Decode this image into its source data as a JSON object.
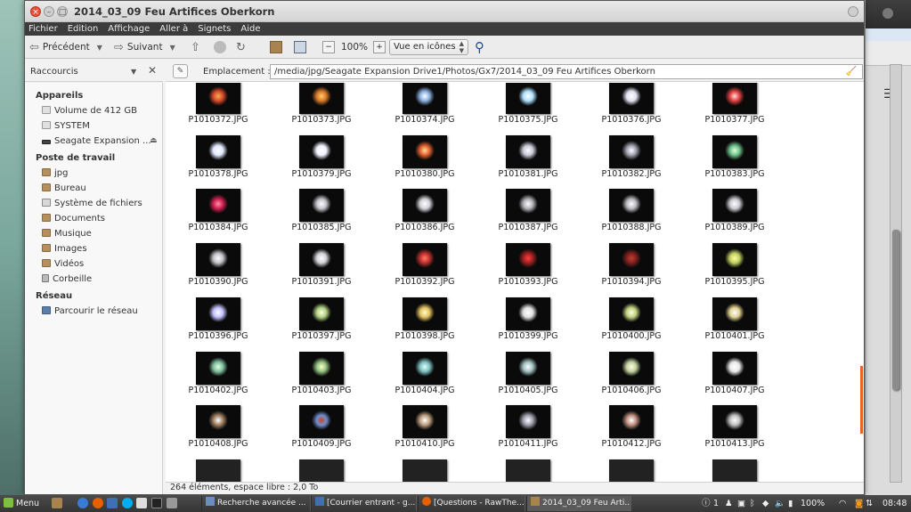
{
  "window": {
    "title": "2014_03_09 Feu Artifices Oberkorn"
  },
  "menubar": [
    "Fichier",
    "Edition",
    "Affichage",
    "Aller à",
    "Signets",
    "Aide"
  ],
  "toolbar": {
    "back_label": "Précédent",
    "forward_label": "Suivant",
    "zoom": "100%",
    "view_mode": "Vue en icônes"
  },
  "sidebar": {
    "header": "Raccourcis",
    "sections": [
      {
        "title": "Appareils",
        "items": [
          {
            "label": "Volume de 412 GB",
            "icon": "drive-icon"
          },
          {
            "label": "SYSTEM",
            "icon": "drive-icon"
          },
          {
            "label": "Seagate Expansion ...",
            "icon": "usb-drive-icon"
          }
        ]
      },
      {
        "title": "Poste de travail",
        "items": [
          {
            "label": "jpg",
            "icon": "folder-icon"
          },
          {
            "label": "Bureau",
            "icon": "folder-icon"
          },
          {
            "label": "Système de fichiers",
            "icon": "filesystem-icon"
          },
          {
            "label": "Documents",
            "icon": "folder-icon"
          },
          {
            "label": "Musique",
            "icon": "folder-icon"
          },
          {
            "label": "Images",
            "icon": "folder-icon"
          },
          {
            "label": "Vidéos",
            "icon": "folder-icon"
          },
          {
            "label": "Corbeille",
            "icon": "trash-icon"
          }
        ]
      },
      {
        "title": "Réseau",
        "items": [
          {
            "label": "Parcourir le réseau",
            "icon": "network-icon"
          }
        ]
      }
    ]
  },
  "location": {
    "label": "Emplacement :",
    "path": "/media/jpg/Seagate Expansion Drive1/Photos/Gx7/2014_03_09 Feu Artifices Oberkorn"
  },
  "files": [
    "P1010372.JPG",
    "P1010373.JPG",
    "P1010374.JPG",
    "P1010375.JPG",
    "P1010376.JPG",
    "P1010377.JPG",
    "P1010378.JPG",
    "P1010379.JPG",
    "P1010380.JPG",
    "P1010381.JPG",
    "P1010382.JPG",
    "P1010383.JPG",
    "P1010384.JPG",
    "P1010385.JPG",
    "P1010386.JPG",
    "P1010387.JPG",
    "P1010388.JPG",
    "P1010389.JPG",
    "P1010390.JPG",
    "P1010391.JPG",
    "P1010392.JPG",
    "P1010393.JPG",
    "P1010394.JPG",
    "P1010395.JPG",
    "P1010396.JPG",
    "P1010397.JPG",
    "P1010398.JPG",
    "P1010399.JPG",
    "P1010400.JPG",
    "P1010401.JPG",
    "P1010402.JPG",
    "P1010403.JPG",
    "P1010404.JPG",
    "P1010405.JPG",
    "P1010406.JPG",
    "P1010407.JPG",
    "P1010408.JPG",
    "P1010409.JPG",
    "P1010410.JPG",
    "P1010411.JPG",
    "P1010412.JPG",
    "P1010413.JPG"
  ],
  "statusbar": "264 éléments, espace libre : 2,0 To",
  "taskbar": {
    "menu_label": "Menu",
    "tasks": [
      {
        "label": "Recherche avancée ...",
        "active": false
      },
      {
        "label": "[Courrier entrant - g...",
        "active": false
      },
      {
        "label": "[Questions - RawThe...",
        "active": false
      },
      {
        "label": "2014_03_09 Feu Arti...",
        "active": true
      }
    ],
    "tray_count": "1",
    "volume": "100%",
    "clock": "08:48"
  },
  "colors": {
    "accent": "#e9622a",
    "menubar_bg": "#3c3c3c",
    "close_button": "#e8503a"
  }
}
